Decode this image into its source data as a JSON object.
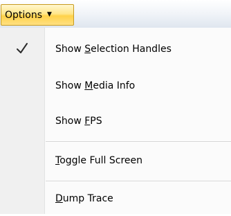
{
  "menu": {
    "title": "Options",
    "icon": "chevron-down-icon"
  },
  "items": [
    {
      "pre": "Show ",
      "mn": "S",
      "post": "election Handles",
      "checked": true
    },
    {
      "pre": "Show ",
      "mn": "M",
      "post": "edia Info",
      "checked": false
    },
    {
      "pre": "Show ",
      "mn": "F",
      "post": "PS",
      "checked": false
    },
    {
      "pre": "",
      "mn": "T",
      "post": "oggle Full Screen",
      "checked": false
    },
    {
      "pre": "",
      "mn": "D",
      "post": "ump Trace",
      "checked": false
    }
  ]
}
